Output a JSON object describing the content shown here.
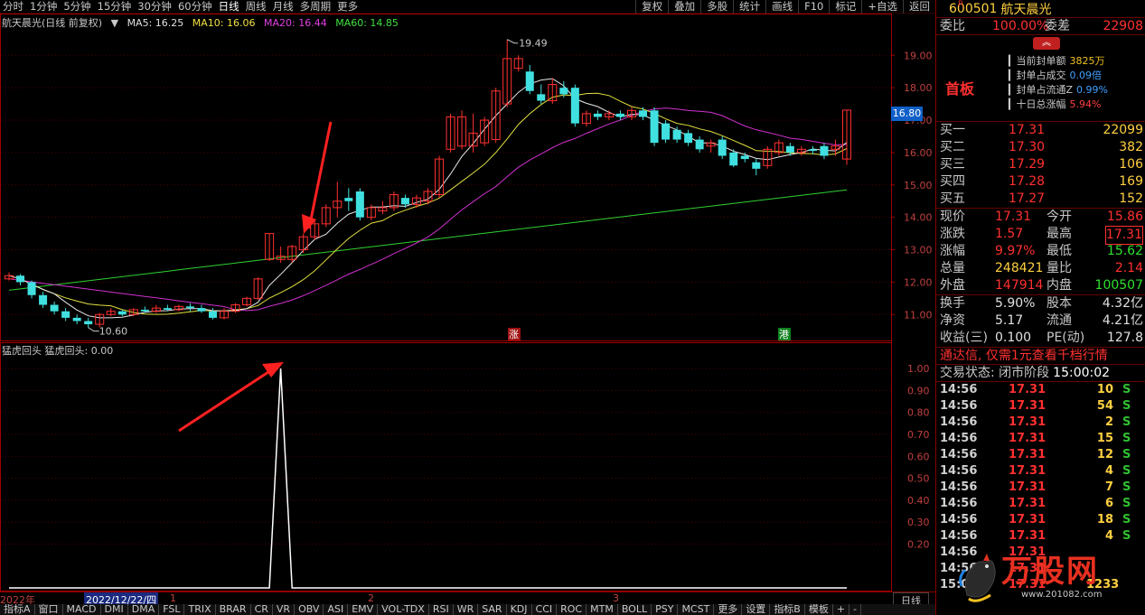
{
  "topbar": {
    "left": [
      "分时",
      "1分钟",
      "5分钟",
      "15分钟",
      "30分钟",
      "60分钟",
      "日线",
      "周线",
      "月线",
      "多周期",
      "更多"
    ],
    "active": "日线",
    "right": [
      "复权",
      "叠加",
      "多股",
      "统计",
      "画线",
      "F10",
      "标记",
      "+自选",
      "返回"
    ]
  },
  "legend": {
    "title": "航天晨光(日线 前复权)",
    "ma5": "MA5: 16.25",
    "ma10": "MA10: 16.06",
    "ma20": "MA20: 16.44",
    "ma60": "MA60: 14.85"
  },
  "sub_legend": "猛虎回头  猛虎回头: 0.00",
  "price_tag": "16.80",
  "annotations": {
    "high": "19.49",
    "low": "10.60",
    "zhang": "涨",
    "gang": "港"
  },
  "chart_data": {
    "type": "candlestick",
    "price_axis": {
      "ticks": [
        "19.00",
        "18.00",
        "17.00",
        "16.00",
        "15.00",
        "14.00",
        "13.00",
        "12.00",
        "11.00"
      ],
      "range": [
        10.2,
        19.9
      ]
    },
    "indicator_axis": {
      "ticks": [
        "1.00",
        "0.90",
        "0.80",
        "0.70",
        "0.60",
        "0.50",
        "0.40",
        "0.30",
        "0.20"
      ],
      "range": [
        0,
        1.05
      ]
    },
    "candles": [
      [
        12.1,
        12.2,
        12.05,
        12.3
      ],
      [
        12.2,
        12.0,
        11.9,
        12.25
      ],
      [
        12.0,
        11.6,
        11.5,
        12.05
      ],
      [
        11.6,
        11.3,
        11.2,
        11.7
      ],
      [
        11.3,
        11.1,
        11.0,
        11.4
      ],
      [
        11.1,
        10.9,
        10.8,
        11.2
      ],
      [
        10.9,
        10.8,
        10.7,
        11.0
      ],
      [
        10.8,
        10.7,
        10.6,
        10.9
      ],
      [
        10.7,
        11.0,
        10.6,
        11.05
      ],
      [
        11.0,
        11.1,
        10.95,
        11.2
      ],
      [
        11.1,
        11.0,
        10.95,
        11.15
      ],
      [
        11.0,
        11.15,
        10.95,
        11.2
      ],
      [
        11.15,
        11.1,
        11.05,
        11.25
      ],
      [
        11.1,
        11.2,
        11.05,
        11.3
      ],
      [
        11.2,
        11.15,
        11.1,
        11.3
      ],
      [
        11.15,
        11.25,
        11.1,
        11.3
      ],
      [
        11.25,
        11.2,
        11.1,
        11.35
      ],
      [
        11.2,
        11.1,
        11.05,
        11.3
      ],
      [
        11.1,
        10.9,
        10.85,
        11.2
      ],
      [
        10.9,
        11.1,
        10.85,
        11.2
      ],
      [
        11.1,
        11.3,
        11.05,
        11.35
      ],
      [
        11.3,
        11.5,
        11.25,
        11.55
      ],
      [
        11.5,
        12.1,
        11.45,
        12.15
      ],
      [
        12.7,
        13.5,
        12.65,
        13.5
      ],
      [
        12.7,
        12.8,
        12.6,
        13.1
      ],
      [
        12.7,
        13.1,
        12.6,
        13.15
      ],
      [
        13.0,
        13.4,
        12.9,
        13.5
      ],
      [
        13.4,
        13.8,
        13.3,
        13.9
      ],
      [
        13.8,
        14.3,
        13.7,
        14.4
      ],
      [
        14.3,
        14.5,
        14.0,
        15.1
      ],
      [
        14.6,
        14.5,
        14.2,
        14.9
      ],
      [
        14.8,
        14.0,
        13.9,
        14.9
      ],
      [
        14.0,
        14.3,
        13.9,
        14.4
      ],
      [
        14.2,
        14.3,
        14.1,
        14.5
      ],
      [
        14.3,
        14.7,
        14.2,
        14.8
      ],
      [
        14.6,
        14.4,
        14.3,
        14.7
      ],
      [
        14.4,
        14.6,
        14.3,
        14.7
      ],
      [
        14.5,
        14.8,
        14.4,
        14.9
      ],
      [
        14.7,
        15.8,
        14.6,
        15.9
      ],
      [
        16.1,
        17.1,
        16.0,
        17.2
      ],
      [
        16.2,
        17.1,
        16.1,
        17.3
      ],
      [
        16.2,
        16.6,
        16.0,
        17.2
      ],
      [
        16.3,
        17.0,
        16.2,
        17.1
      ],
      [
        16.4,
        17.9,
        16.3,
        18.0
      ],
      [
        17.5,
        18.9,
        17.4,
        19.49
      ],
      [
        18.6,
        18.9,
        18.5,
        19.0
      ],
      [
        18.5,
        17.9,
        17.8,
        18.7
      ],
      [
        17.8,
        17.6,
        17.5,
        18.1
      ],
      [
        17.6,
        18.1,
        17.5,
        18.3
      ],
      [
        18.0,
        17.8,
        17.7,
        18.2
      ],
      [
        18.0,
        16.9,
        16.8,
        18.1
      ],
      [
        16.9,
        17.2,
        16.8,
        17.3
      ],
      [
        17.2,
        17.1,
        17.0,
        17.3
      ],
      [
        17.1,
        17.2,
        17.0,
        17.3
      ],
      [
        17.2,
        17.1,
        17.0,
        17.3
      ],
      [
        17.1,
        17.3,
        17.0,
        17.4
      ],
      [
        17.3,
        17.1,
        17.0,
        17.4
      ],
      [
        17.3,
        16.3,
        16.2,
        17.4
      ],
      [
        16.9,
        16.4,
        16.3,
        17.0
      ],
      [
        16.7,
        16.4,
        16.3,
        16.8
      ],
      [
        16.6,
        16.3,
        16.2,
        16.7
      ],
      [
        16.4,
        16.1,
        16.0,
        16.5
      ],
      [
        16.2,
        16.3,
        16.0,
        16.4
      ],
      [
        16.4,
        15.9,
        15.8,
        16.5
      ],
      [
        16.0,
        15.6,
        15.55,
        16.1
      ],
      [
        15.9,
        15.8,
        15.7,
        16.0
      ],
      [
        15.7,
        15.5,
        15.3,
        15.8
      ],
      [
        15.6,
        16.1,
        15.5,
        16.2
      ],
      [
        16.0,
        16.3,
        15.9,
        16.4
      ],
      [
        16.2,
        16.0,
        15.9,
        16.3
      ],
      [
        16.0,
        16.1,
        15.9,
        16.2
      ],
      [
        16.1,
        16.05,
        15.95,
        16.2
      ],
      [
        16.2,
        15.9,
        15.8,
        16.3
      ],
      [
        16.1,
        16.2,
        15.9,
        16.4
      ],
      [
        15.8,
        17.31,
        15.62,
        17.31
      ]
    ],
    "indicator_values": [
      0,
      0,
      0,
      0,
      0,
      0,
      0,
      0,
      0,
      0,
      0,
      0,
      0,
      0,
      0,
      0,
      0,
      0,
      0,
      0,
      0,
      0,
      0,
      0,
      1,
      0,
      0,
      0,
      0,
      0,
      0,
      0,
      0,
      0,
      0,
      0,
      0,
      0,
      0,
      0,
      0,
      0,
      0,
      0,
      0,
      0,
      0,
      0,
      0,
      0,
      0,
      0,
      0,
      0,
      0,
      0,
      0,
      0,
      0,
      0,
      0,
      0,
      0,
      0,
      0,
      0,
      0,
      0,
      0,
      0,
      0,
      0,
      0,
      0,
      0
    ]
  },
  "datebar": {
    "year": "2022年",
    "selected": "2022/12/22/四",
    "months": [
      "1",
      "2",
      "3"
    ],
    "period": "日线"
  },
  "tabs": [
    "指标A",
    "窗口",
    "MACD",
    "DMI",
    "DMA",
    "FSL",
    "TRIX",
    "BRAR",
    "CR",
    "VR",
    "OBV",
    "ASI",
    "EMV",
    "VOL-TDX",
    "RSI",
    "WR",
    "SAR",
    "KDJ",
    "CCI",
    "ROC",
    "MTM",
    "BOLL",
    "PSY",
    "MCST",
    "更多",
    "设置",
    "指标B",
    "模板",
    "+",
    "-"
  ],
  "rpanel": {
    "code": "600501",
    "name": "航天晨光",
    "weibi_label": "委比",
    "weibi": "100.00%",
    "weicha_label": "委差",
    "weicha": "22908",
    "first_board": "首板",
    "seal": [
      {
        "label": "当前封单额",
        "value": "3825万"
      },
      {
        "label": "封单占成交",
        "value": "0.09倍"
      },
      {
        "label": "封单占流通Z",
        "value": "0.99%"
      },
      {
        "label": "十日总涨幅",
        "value": "5.94%"
      }
    ],
    "bids": [
      {
        "label": "买一",
        "price": "17.31",
        "vol": "22099"
      },
      {
        "label": "买二",
        "price": "17.30",
        "vol": "382"
      },
      {
        "label": "买三",
        "price": "17.29",
        "vol": "106"
      },
      {
        "label": "买四",
        "price": "17.28",
        "vol": "169"
      },
      {
        "label": "买五",
        "price": "17.27",
        "vol": "152"
      }
    ],
    "quote": [
      {
        "l1": "现价",
        "v1": "17.31",
        "l2": "今开",
        "v2": "15.86"
      },
      {
        "l1": "涨跌",
        "v1": "1.57",
        "l2": "最高",
        "v2": "17.31"
      },
      {
        "l1": "涨幅",
        "v1": "9.97%",
        "l2": "最低",
        "v2": "15.62"
      },
      {
        "l1": "总量",
        "v1": "248421",
        "l2": "量比",
        "v2": "2.14"
      },
      {
        "l1": "外盘",
        "v1": "147914",
        "l2": "内盘",
        "v2": "100507"
      }
    ],
    "stats": [
      {
        "l1": "换手",
        "v1": "5.90%",
        "l2": "股本",
        "v2": "4.32亿"
      },
      {
        "l1": "净资",
        "v1": "5.17",
        "l2": "流通",
        "v2": "4.21亿"
      },
      {
        "l1": "收益(三)",
        "v1": "0.100",
        "l2": "PE(动)",
        "v2": "127.8"
      }
    ],
    "ticker": "通达信, 仅需1元查看千档行情",
    "status_label": "交易状态: 闭市阶段",
    "status_time": "15:00:02",
    "trades": [
      {
        "t": "14:56",
        "p": "17.31",
        "v": "10",
        "s": "S"
      },
      {
        "t": "14:56",
        "p": "17.31",
        "v": "54",
        "s": "S"
      },
      {
        "t": "14:56",
        "p": "17.31",
        "v": "2",
        "s": "S"
      },
      {
        "t": "14:56",
        "p": "17.31",
        "v": "15",
        "s": "S"
      },
      {
        "t": "14:56",
        "p": "17.31",
        "v": "12",
        "s": "S"
      },
      {
        "t": "14:56",
        "p": "17.31",
        "v": "4",
        "s": "S"
      },
      {
        "t": "14:56",
        "p": "17.31",
        "v": "7",
        "s": "S"
      },
      {
        "t": "14:56",
        "p": "17.31",
        "v": "6",
        "s": "S"
      },
      {
        "t": "14:56",
        "p": "17.31",
        "v": "18",
        "s": "S"
      },
      {
        "t": "14:56",
        "p": "17.31",
        "v": "4",
        "s": "S"
      },
      {
        "t": "14:56",
        "p": "17.31",
        "v": "",
        "s": ""
      },
      {
        "t": "14:56",
        "p": "17.31",
        "v": "",
        "s": ""
      },
      {
        "t": "15:00",
        "p": "17.31",
        "v": "1233",
        "s": ""
      }
    ],
    "logo_text": "万股网",
    "logo_url": "www.201082.com"
  }
}
